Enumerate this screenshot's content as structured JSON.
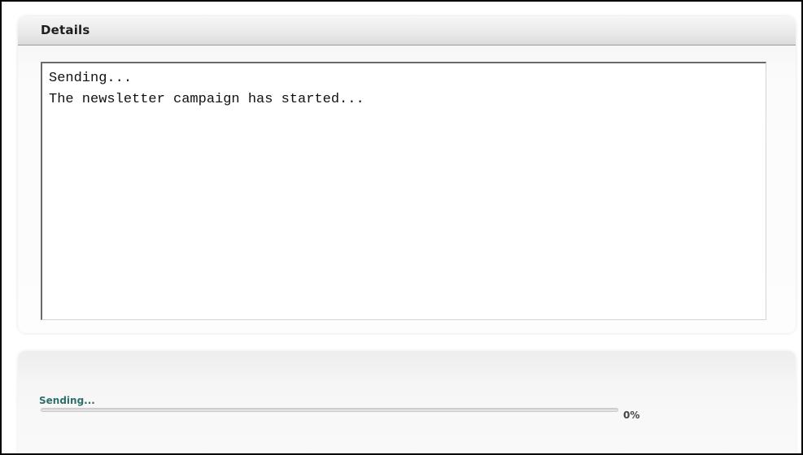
{
  "details_panel": {
    "title": "Details",
    "log_lines": [
      "Sending...",
      "The newsletter campaign has started..."
    ]
  },
  "progress_panel": {
    "status_text": "Sending...",
    "percent_label": "0%",
    "progress_fraction": 0.0
  },
  "colors": {
    "status_text": "#2f6f6a",
    "frame_border": "#000000"
  }
}
